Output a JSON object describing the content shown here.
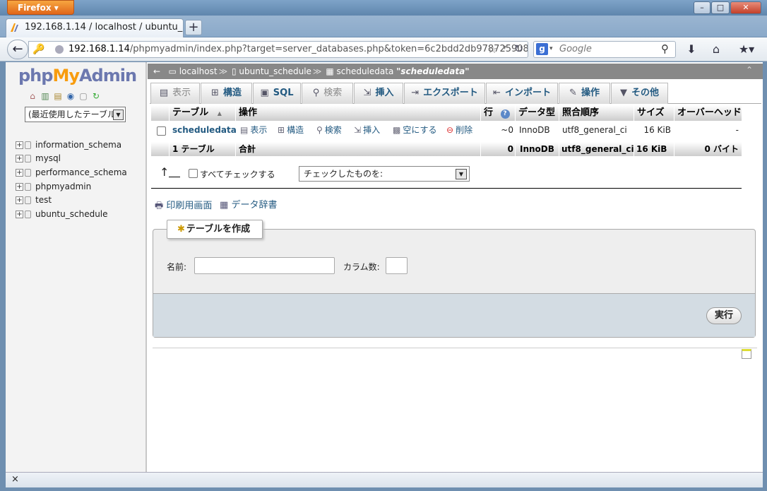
{
  "browser": {
    "app_button": "Firefox",
    "window_controls": {
      "minimize": "–",
      "maximize": "□",
      "close": "✕"
    },
    "tab_title": "192.168.1.14 / localhost / ubuntu_...",
    "new_tab": "+",
    "url_host": "192.168.1.14",
    "url_path": "/phpmyadmin/index.php?target=server_databases.php&token=6c2bdd2db978725908",
    "search_placeholder": "Google",
    "status_close": "×"
  },
  "sidebar": {
    "logo_php": "php",
    "logo_my": "My",
    "logo_admin": "Admin",
    "recent_select": "(最近使用したテーブル",
    "databases": [
      "information_schema",
      "mysql",
      "performance_schema",
      "phpmyadmin",
      "test",
      "ubuntu_schedule"
    ]
  },
  "breadcrumb": {
    "server": "localhost",
    "database": "ubuntu_schedule",
    "table": "scheduledata",
    "table_quoted": "\"scheduledata\""
  },
  "tabs": [
    {
      "label": "表示",
      "icon": "▤",
      "disabled": true
    },
    {
      "label": "構造",
      "icon": "⊞",
      "disabled": false
    },
    {
      "label": "SQL",
      "icon": "▣",
      "disabled": false
    },
    {
      "label": "検索",
      "icon": "⚲",
      "disabled": true
    },
    {
      "label": "挿入",
      "icon": "⇲",
      "disabled": false
    },
    {
      "label": "エクスポート",
      "icon": "⇥",
      "disabled": false
    },
    {
      "label": "インポート",
      "icon": "⇤",
      "disabled": false
    },
    {
      "label": "操作",
      "icon": "✎",
      "disabled": false
    },
    {
      "label": "その他",
      "icon": "▼",
      "disabled": false
    }
  ],
  "table": {
    "headers": {
      "table": "テーブル",
      "sort_arrow": "▲",
      "actions": "操作",
      "rows": "行",
      "rows_help": "?",
      "type": "データ型",
      "collation": "照合順序",
      "size": "サイズ",
      "overhead": "オーバーヘッド"
    },
    "row": {
      "name": "scheduledata",
      "actions": {
        "browse": "表示",
        "structure": "構造",
        "search": "検索",
        "insert": "挿入",
        "empty": "空にする",
        "drop": "削除"
      },
      "rows": "~0",
      "type": "InnoDB",
      "collation": "utf8_general_ci",
      "size": "16 KiB",
      "overhead": "-"
    },
    "footer": {
      "count": "1 テーブル",
      "sum": "合計",
      "rows": "0",
      "type": "InnoDB",
      "collation": "utf8_general_ci",
      "size": "16 KiB",
      "overhead": "0 バイト"
    }
  },
  "bulk": {
    "check_all": "すべてチェックする",
    "with_selected": "チェックしたものを:"
  },
  "links": {
    "print": "印刷用画面",
    "dictionary": "データ辞書"
  },
  "create_table": {
    "legend": "テーブルを作成",
    "name_label": "名前:",
    "columns_label": "カラム数:",
    "go": "実行"
  }
}
